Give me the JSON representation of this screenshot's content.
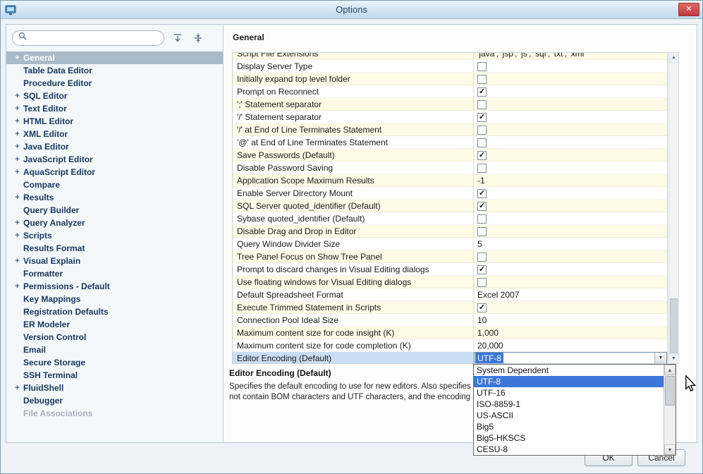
{
  "window": {
    "title": "Options"
  },
  "icons": {
    "close": "✕",
    "expander": "+",
    "check": "✓",
    "combo_arrow": "▼",
    "scroll_up": "▲",
    "scroll_down": "▼"
  },
  "colors": {
    "accent_selection": "#3c78d8",
    "row_alternate": "#fbfbe6",
    "sidebar_selection": "#a9bac8",
    "close_button": "#c13b3b",
    "titlebar_gradient_top": "#eaf4fc",
    "titlebar_gradient_bottom": "#bdd8ec"
  },
  "sidebar": {
    "search_placeholder": "",
    "search_value": "",
    "items": [
      {
        "label": "General",
        "expandable": true,
        "selected": true
      },
      {
        "label": "Table Data Editor"
      },
      {
        "label": "Procedure Editor"
      },
      {
        "label": "SQL Editor",
        "expandable": true
      },
      {
        "label": "Text Editor",
        "expandable": true
      },
      {
        "label": "HTML Editor",
        "expandable": true
      },
      {
        "label": "XML Editor",
        "expandable": true
      },
      {
        "label": "Java Editor",
        "expandable": true
      },
      {
        "label": "JavaScript Editor",
        "expandable": true
      },
      {
        "label": "AquaScript Editor",
        "expandable": true
      },
      {
        "label": "Compare"
      },
      {
        "label": "Results",
        "expandable": true
      },
      {
        "label": "Query Builder"
      },
      {
        "label": "Query Analyzer",
        "expandable": true
      },
      {
        "label": "Scripts",
        "expandable": true
      },
      {
        "label": "Results Format"
      },
      {
        "label": "Visual Explain",
        "expandable": true
      },
      {
        "label": "Formatter"
      },
      {
        "label": "Permissions - Default",
        "expandable": true
      },
      {
        "label": "Key Mappings"
      },
      {
        "label": "Registration Defaults"
      },
      {
        "label": "ER Modeler"
      },
      {
        "label": "Version Control"
      },
      {
        "label": "Email"
      },
      {
        "label": "Secure Storage"
      },
      {
        "label": "SSH Terminal"
      },
      {
        "label": "FluidShell",
        "expandable": true
      },
      {
        "label": "Debugger"
      },
      {
        "label": "File Associations",
        "disabled": true
      }
    ]
  },
  "main": {
    "header": "General",
    "rows": [
      {
        "label": "Script File Extensions",
        "type": "text",
        "value": "'java', 'jsp', 'js', 'sql', 'txt', 'xml'",
        "clipped": true
      },
      {
        "label": "Display Server Type",
        "type": "checkbox",
        "checked": false
      },
      {
        "label": "Initially expand top level folder",
        "type": "checkbox",
        "checked": false
      },
      {
        "label": "Prompt on Reconnect",
        "type": "checkbox",
        "checked": true
      },
      {
        "label": "';' Statement separator",
        "type": "checkbox",
        "checked": false
      },
      {
        "label": "'/' Statement separator",
        "type": "checkbox",
        "checked": true
      },
      {
        "label": "'/' at End of Line Terminates Statement",
        "type": "checkbox",
        "checked": false
      },
      {
        "label": "'@' at End of Line Terminates Statement",
        "type": "checkbox",
        "checked": false
      },
      {
        "label": "Save Passwords (Default)",
        "type": "checkbox",
        "checked": true
      },
      {
        "label": "Disable Password Saving",
        "type": "checkbox",
        "checked": false
      },
      {
        "label": "Application Scope Maximum Results",
        "type": "text",
        "value": "-1"
      },
      {
        "label": "Enable Server Directory Mount",
        "type": "checkbox",
        "checked": true
      },
      {
        "label": "SQL Server quoted_identifier (Default)",
        "type": "checkbox",
        "checked": true
      },
      {
        "label": "Sybase quoted_identifier (Default)",
        "type": "checkbox",
        "checked": false
      },
      {
        "label": "Disable Drag and Drop in Editor",
        "type": "checkbox",
        "checked": false
      },
      {
        "label": "Query Window Divider Size",
        "type": "text",
        "value": "5"
      },
      {
        "label": "Tree Panel Focus on Show Tree Panel",
        "type": "checkbox",
        "checked": false
      },
      {
        "label": "Prompt to discard changes in Visual Editing dialogs",
        "type": "checkbox",
        "checked": true
      },
      {
        "label": "Use floating windows for Visual Editing dialogs",
        "type": "checkbox",
        "checked": false
      },
      {
        "label": "Default Spreadsheet Format",
        "type": "text",
        "value": "Excel 2007"
      },
      {
        "label": "Execute Trimmed Statement in Scripts",
        "type": "checkbox",
        "checked": true
      },
      {
        "label": "Connection Pool Ideal Size",
        "type": "text",
        "value": "10"
      },
      {
        "label": "Maximum content size for code insight (K)",
        "type": "text",
        "value": "1,000"
      },
      {
        "label": "Maximum content size for code completion (K)",
        "type": "text",
        "value": "20,000"
      },
      {
        "label": "Editor Encoding (Default)",
        "type": "combo",
        "value": "UTF-8",
        "selected": true
      }
    ]
  },
  "description": {
    "title": "Editor Encoding (Default)",
    "line1": "Specifies the default encoding to use for new editors. Also specifies the e",
    "line2": "not contain BOM characters and UTF characters, and the encoding is no"
  },
  "dropdown": {
    "selected": "UTF-8",
    "items": [
      "System Dependent",
      "UTF-8",
      "UTF-16",
      "ISO-8859-1",
      "US-ASCII",
      "Big5",
      "Big5-HKSCS",
      "CESU-8"
    ]
  },
  "buttons": {
    "ok": "OK",
    "cancel": "Cancel"
  }
}
